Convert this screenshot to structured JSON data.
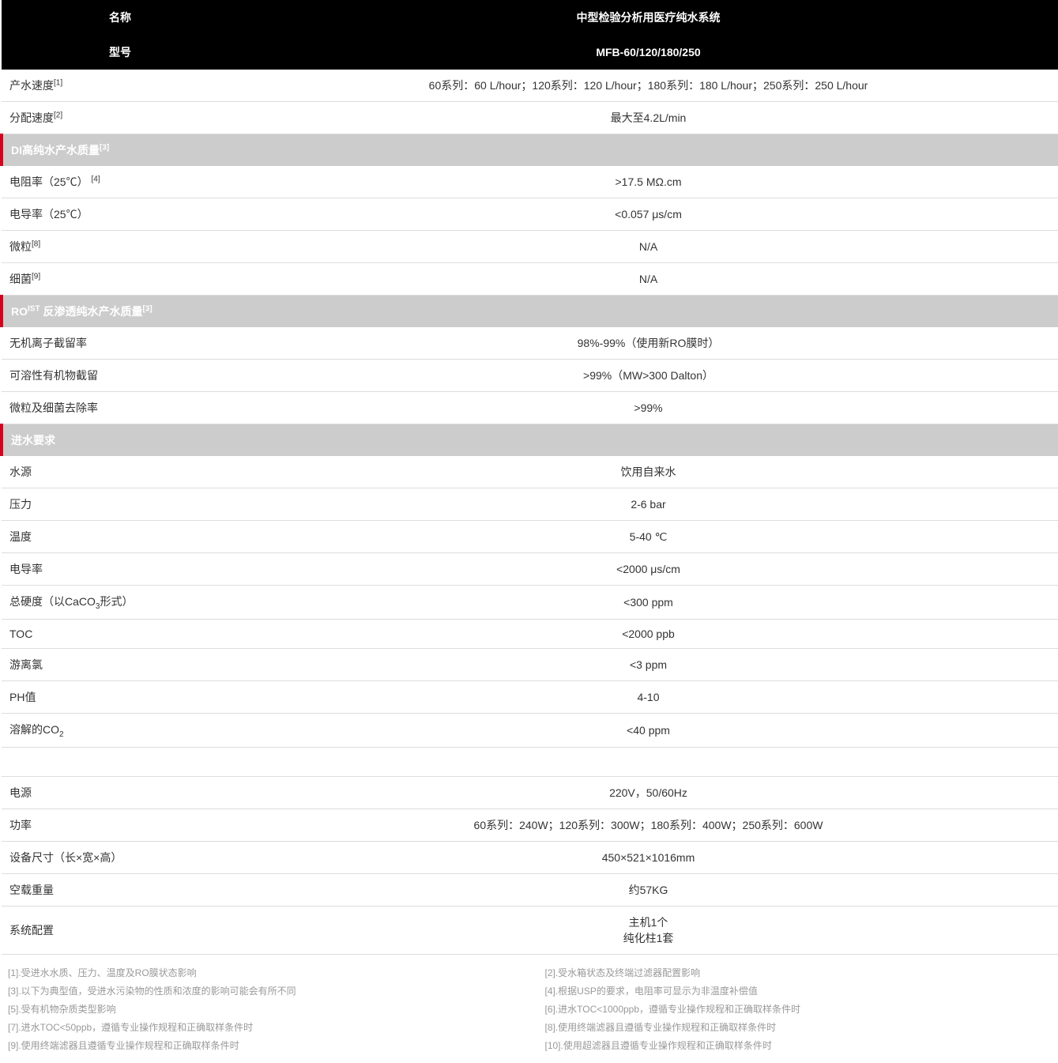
{
  "header": {
    "name_label": "名称",
    "name_value": "中型检验分析用医疗纯水系统",
    "model_label": "型号",
    "model_value": "MFB-60/120/180/250"
  },
  "sections": {
    "di_quality": "DI高纯水产水质量",
    "ro_quality": "RO 反渗透纯水产水质量",
    "feed_req": "进水要求"
  },
  "rows": {
    "prod_rate": {
      "label": "产水速度",
      "sup": "[1]",
      "value": "60系列：60 L/hour；120系列：120 L/hour；180系列：180 L/hour；250系列：250 L/hour"
    },
    "disp_rate": {
      "label": "分配速度",
      "sup": "[2]",
      "value": "最大至4.2L/min"
    },
    "resistivity": {
      "label": "电阻率（25℃）",
      "sup": "[4]",
      "value": ">17.5 MΩ.cm"
    },
    "conductivity25": {
      "label": "电导率（25℃）",
      "value": "<0.057 μs/cm"
    },
    "particles": {
      "label": "微粒",
      "sup": "[8]",
      "value": "N/A"
    },
    "bacteria": {
      "label": "细菌",
      "sup": "[9]",
      "value": "N/A"
    },
    "ion_rej": {
      "label": "无机离子截留率",
      "value": "98%-99%（使用新RO膜时）"
    },
    "org_rej": {
      "label": "可溶性有机物截留",
      "value": ">99%（MW>300 Dalton）"
    },
    "part_bact_rem": {
      "label": "微粒及细菌去除率",
      "value": ">99%"
    },
    "source": {
      "label": "水源",
      "value": "饮用自来水"
    },
    "pressure": {
      "label": "压力",
      "value": "2-6 bar"
    },
    "temp": {
      "label": "温度",
      "value": "5-40 ℃"
    },
    "cond": {
      "label": "电导率",
      "value": "<2000 μs/cm"
    },
    "hardness": {
      "label_pre": "总硬度（以CaCO",
      "label_sub": "3",
      "label_post": "形式）",
      "value": "<300 ppm"
    },
    "toc": {
      "label": "TOC",
      "value": "<2000 ppb"
    },
    "freecl": {
      "label": "游离氯",
      "value": "<3 ppm"
    },
    "ph": {
      "label": "PH值",
      "value": "4-10"
    },
    "co2": {
      "label_pre": "溶解的CO",
      "label_sub": "2",
      "value": "<40 ppm"
    },
    "power_src": {
      "label": "电源",
      "value": "220V，50/60Hz"
    },
    "power": {
      "label": "功率",
      "value": "60系列：240W；120系列：300W；180系列：400W；250系列：600W"
    },
    "dim": {
      "label": "设备尺寸（长×宽×高）",
      "value": "450×521×1016mm"
    },
    "weight": {
      "label": "空载重量",
      "value": "约57KG"
    },
    "config": {
      "label": "系统配置",
      "value": "主机1个\n纯化柱1套"
    }
  },
  "section_sup": "[3]",
  "footnotes": [
    "[1].受进水水质、压力、温度及RO膜状态影响",
    "[2].受水箱状态及终端过滤器配置影响",
    "[3].以下为典型值，受进水污染物的性质和浓度的影响可能会有所不同",
    "[4].根据USP的要求，电阻率可显示为非温度补偿值",
    "[5].受有机物杂质类型影响",
    "[6].进水TOC<1000ppb，遵循专业操作规程和正确取样条件时",
    "[7].进水TOC<50ppb，遵循专业操作规程和正确取样条件时",
    "[8].使用终端滤器且遵循专业操作规程和正确取样条件时",
    "[9].使用终端滤器且遵循专业操作规程和正确取样条件时",
    "[10].使用超滤器且遵循专业操作规程和正确取样条件时"
  ]
}
